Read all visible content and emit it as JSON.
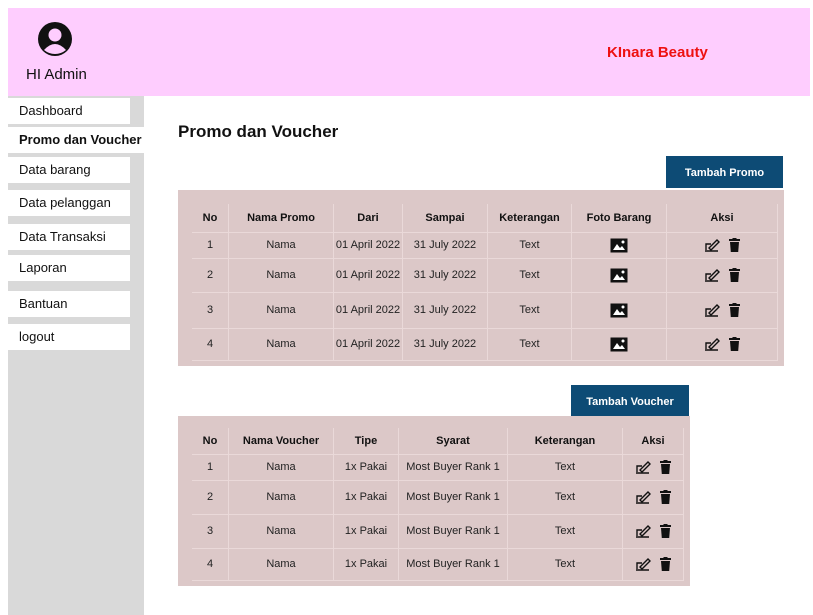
{
  "header": {
    "greeting": "HI Admin",
    "brand": "KInara Beauty"
  },
  "sidebar": {
    "items": [
      {
        "label": "Dashboard"
      },
      {
        "label": "Promo dan Voucher"
      },
      {
        "label": "Data barang"
      },
      {
        "label": "Data pelanggan"
      },
      {
        "label": "Data Transaksi"
      },
      {
        "label": "Laporan"
      },
      {
        "label": "Bantuan"
      },
      {
        "label": "logout"
      }
    ],
    "active": "Promo dan Voucher"
  },
  "main": {
    "title": "Promo dan Voucher",
    "promo_button": "Tambah Promo",
    "voucher_button": "Tambah Voucher",
    "promo_table": {
      "headers": [
        "No",
        "Nama Promo",
        "Dari",
        "Sampai",
        "Keterangan",
        "Foto Barang",
        "Aksi"
      ],
      "rows": [
        {
          "no": "1",
          "nama": "Nama",
          "dari": "01 April 2022",
          "sampai": "31 July 2022",
          "keterangan": "Text"
        },
        {
          "no": "2",
          "nama": "Nama",
          "dari": "01 April 2022",
          "sampai": "31 July 2022",
          "keterangan": "Text"
        },
        {
          "no": "3",
          "nama": "Nama",
          "dari": "01 April 2022",
          "sampai": "31 July 2022",
          "keterangan": "Text"
        },
        {
          "no": "4",
          "nama": "Nama",
          "dari": "01 April 2022",
          "sampai": "31 July 2022",
          "keterangan": "Text"
        }
      ]
    },
    "voucher_table": {
      "headers": [
        "No",
        "Nama Voucher",
        "Tipe",
        "Syarat",
        "Keterangan",
        "Aksi"
      ],
      "rows": [
        {
          "no": "1",
          "nama": "Nama",
          "tipe": "1x Pakai",
          "syarat": "Most Buyer Rank 1",
          "keterangan": "Text"
        },
        {
          "no": "2",
          "nama": "Nama",
          "tipe": "1x Pakai",
          "syarat": "Most Buyer Rank 1",
          "keterangan": "Text"
        },
        {
          "no": "3",
          "nama": "Nama",
          "tipe": "1x Pakai",
          "syarat": "Most Buyer Rank 1",
          "keterangan": "Text"
        },
        {
          "no": "4",
          "nama": "Nama",
          "tipe": "1x Pakai",
          "syarat": "Most Buyer Rank 1",
          "keterangan": "Text"
        }
      ]
    }
  },
  "icons": {
    "avatar": "user-avatar-icon",
    "photo": "image-icon",
    "edit": "edit-icon",
    "delete": "trash-icon"
  },
  "colors": {
    "header_bg": "#fecdfe",
    "brand": "#ee1111",
    "sidebar_bg": "#d9d9d9",
    "button_bg": "#0d4b75",
    "table_bg": "#dcc8c8"
  }
}
